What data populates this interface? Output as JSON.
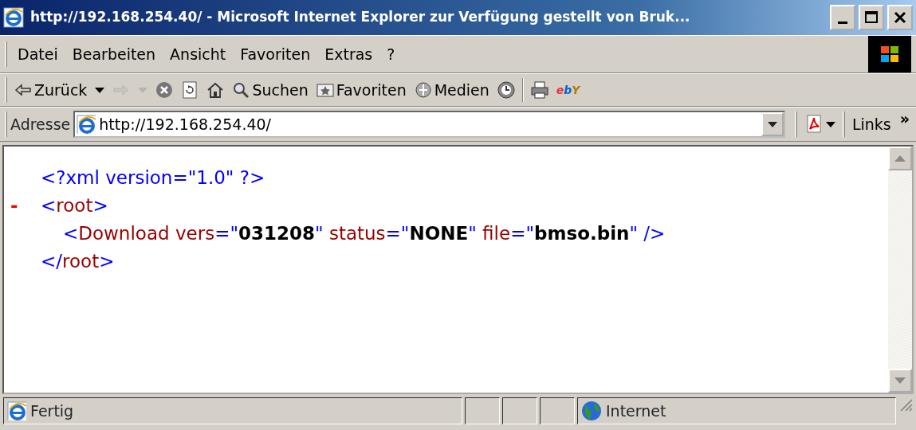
{
  "window": {
    "title": "http://192.168.254.40/ - Microsoft Internet Explorer  zur Verfügung gestellt von Bruk..."
  },
  "menu": [
    "Datei",
    "Bearbeiten",
    "Ansicht",
    "Favoriten",
    "Extras",
    "?"
  ],
  "toolbar": [
    {
      "kind": "back",
      "label": "Zurück",
      "disabled": false
    },
    {
      "kind": "forward",
      "disabled": true
    },
    {
      "kind": "stop",
      "disabled": false
    },
    {
      "kind": "refresh",
      "disabled": false
    },
    {
      "kind": "home",
      "disabled": false
    },
    {
      "kind": "search",
      "label": "Suchen",
      "disabled": false
    },
    {
      "kind": "favorites",
      "label": "Favoriten",
      "disabled": false
    },
    {
      "kind": "media",
      "label": "Medien",
      "disabled": false
    },
    {
      "kind": "history",
      "disabled": false
    },
    {
      "kind": "print",
      "disabled": false
    },
    {
      "kind": "logo",
      "label": "ebY",
      "disabled": false
    }
  ],
  "address": {
    "label": "Adresse",
    "value": "http://192.168.254.40/"
  },
  "links": {
    "label": "Links",
    "chevron": "»"
  },
  "document": {
    "declaration": [
      {
        "kind": "punct",
        "text": "<?xml version=\"1.0\" ?>"
      }
    ],
    "nodes": [
      {
        "toggle": "-",
        "open": [
          {
            "kind": "punct",
            "text": "<"
          },
          {
            "kind": "name",
            "text": "root"
          },
          {
            "kind": "punct",
            "text": ">"
          }
        ],
        "children": [
          {
            "open": [
              {
                "kind": "punct",
                "text": "<"
              },
              {
                "kind": "name",
                "text": "Download vers"
              },
              {
                "kind": "punct",
                "text": "=\""
              },
              {
                "kind": "value",
                "text": "031208"
              },
              {
                "kind": "punct",
                "text": "\""
              },
              {
                "kind": "name",
                "text": " status"
              },
              {
                "kind": "punct",
                "text": "=\""
              },
              {
                "kind": "value",
                "text": "NONE"
              },
              {
                "kind": "punct",
                "text": "\""
              },
              {
                "kind": "name",
                "text": " file"
              },
              {
                "kind": "punct",
                "text": "=\""
              },
              {
                "kind": "value",
                "text": "bmso.bin"
              },
              {
                "kind": "punct",
                "text": "\" />"
              }
            ]
          }
        ],
        "close": [
          {
            "kind": "punct",
            "text": "</"
          },
          {
            "kind": "name",
            "text": "root"
          },
          {
            "kind": "punct",
            "text": ">"
          }
        ]
      }
    ]
  },
  "status_bar": {
    "text": "Fertig",
    "zone": "Internet"
  }
}
